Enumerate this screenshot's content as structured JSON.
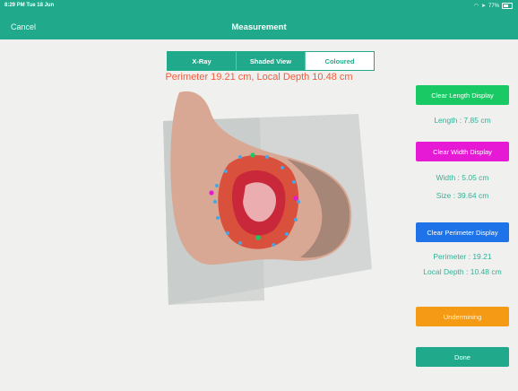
{
  "status": {
    "time": "8:29 PM  Tue 18 Jun",
    "battery": "77%"
  },
  "nav": {
    "cancel": "Cancel",
    "title": "Measurement"
  },
  "segments": [
    {
      "label": "X-Ray",
      "selected": false
    },
    {
      "label": "Shaded View",
      "selected": false
    },
    {
      "label": "Coloured",
      "selected": true
    }
  ],
  "headline": "Perimeter 19.21 cm, Local Depth 10.48 cm",
  "panel": {
    "clear_length": "Clear Length Display",
    "length": "Length : 7.85 cm",
    "clear_width": "Clear Width Display",
    "width": "Width : 5.05 cm",
    "size": "Size : 39.64 cm",
    "clear_perimeter": "Clear Perimeter Display",
    "perimeter": "Perimeter : 19.21",
    "local_depth": "Local Depth : 10.48 cm",
    "undermining": "Undermining",
    "done": "Done"
  },
  "colors": {
    "accent": "#20a98a",
    "headline": "#f25a3a",
    "length_button": "#19c964",
    "width_button": "#e619d4",
    "perimeter_button": "#1f73e8",
    "undermining_button": "#f59a14",
    "done_button": "#20a98a"
  }
}
